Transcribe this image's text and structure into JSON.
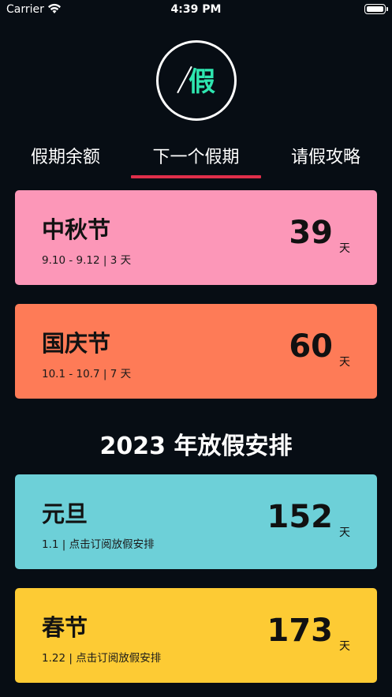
{
  "status_bar": {
    "carrier": "Carrier",
    "time": "4:39 PM"
  },
  "logo": {
    "char": "假",
    "accent_color": "#2ee6b0"
  },
  "tabs": [
    {
      "label": "假期余额"
    },
    {
      "label": "下一个假期",
      "active": true
    },
    {
      "label": "请假攻略"
    }
  ],
  "tab_underline_color": "#e02e4a",
  "upcoming": [
    {
      "name": "中秋节",
      "sub": "9.10 - 9.12 | 3 天",
      "days": "39",
      "unit": "天",
      "color": "#fc97b8"
    },
    {
      "name": "国庆节",
      "sub": "10.1 - 10.7 | 7 天",
      "days": "60",
      "unit": "天",
      "color": "#fe7b57"
    }
  ],
  "section_title": "2023 年放假安排",
  "schedule": [
    {
      "name": "元旦",
      "sub": "1.1 | 点击订阅放假安排",
      "days": "152",
      "unit": "天",
      "color": "#6dd0d8"
    },
    {
      "name": "春节",
      "sub": "1.22 | 点击订阅放假安排",
      "days": "173",
      "unit": "天",
      "color": "#fdcb34"
    }
  ]
}
